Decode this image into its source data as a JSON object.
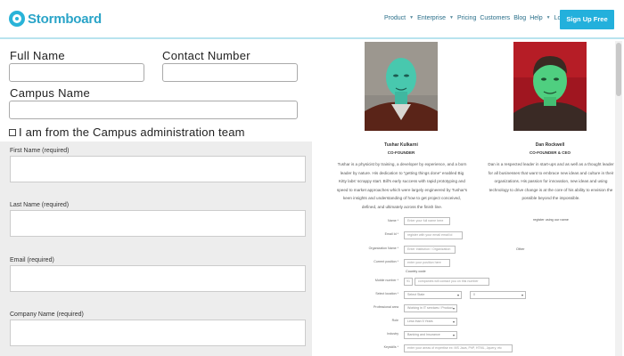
{
  "header": {
    "logo": "Stormboard",
    "nav": {
      "product": "Product",
      "enterprise": "Enterprise",
      "pricing": "Pricing",
      "customers": "Customers",
      "blog": "Blog",
      "help": "Help",
      "login": "Login →"
    },
    "signup": "Sign Up Free"
  },
  "form": {
    "full_name_label": "Full Name",
    "contact_number_label": "Contact Number",
    "campus_name_label": "Campus Name",
    "campus_admin_checkbox": "I am from the Campus administration team",
    "first_name_label": "First Name (required)",
    "last_name_label": "Last Name (required)",
    "email_label": "Email (required)",
    "company_name_label": "Company Name (required)"
  },
  "founders": [
    {
      "name": "Tushar Kulkarni",
      "role": "CO-FOUNDER",
      "bio": [
        "Tushar is a physicist by training, a developer by experience, and a born",
        "leader by nature. His dedication to “getting things done” enabled Big",
        "Kitty labs' scrappy start. Bill's early success with rapid prototyping and",
        "speed to market approaches which were largely engineered by Tushar's",
        "keen insights and understanding of how to get project conceived,",
        "defined, and ultimately across the finish line."
      ]
    },
    {
      "name": "Dan Rockwell",
      "role": "CO-FOUNDER & CEO",
      "bio": [
        "Dan is a respected leader in start-ups and as well as a thought leader",
        "for all businesses that want to embrace new ideas and culture in their",
        "organizations. His passion for innovation, new ideas and using",
        "technology to drive change is at the core of his ability to envision the",
        "possible beyond the impossible."
      ]
    }
  ],
  "small_form": {
    "name_label": "Name *",
    "name_placeholder": "Enter your full name here",
    "register_note": "register using our name",
    "email_label": "Email Id *",
    "email_placeholder": "register with your email email id",
    "organization_label": "Organization Name *",
    "organization_placeholder": "Enter Institution / Organization",
    "other_label": "Other",
    "position_label": "Current position *",
    "position_placeholder": "enter your position here",
    "country_code_note": "Country code",
    "mobile_label": "Mobile number *",
    "mobile_prefix": "91",
    "mobile_placeholder": "companies will contact you on this number",
    "select_country_label": "Select location *",
    "select_country_value": "Select State",
    "select_city_value": "0",
    "professional_label": "Professional area",
    "professional_value": "Working in IT services / Product",
    "role_label": "Role",
    "role_value": "Less than 5 Years",
    "industry_label": "Industry",
    "industry_value": "Banking and Insurance",
    "skills_label": "Keyskills *",
    "skills_placeholder": "enter your areas of expertise ex: MS Java, PhP, HTML, Jquery, etc"
  },
  "colors": {
    "brand": "#2aa4c8",
    "signup_bg": "#23b0dc",
    "form_gray": "#ededed"
  }
}
